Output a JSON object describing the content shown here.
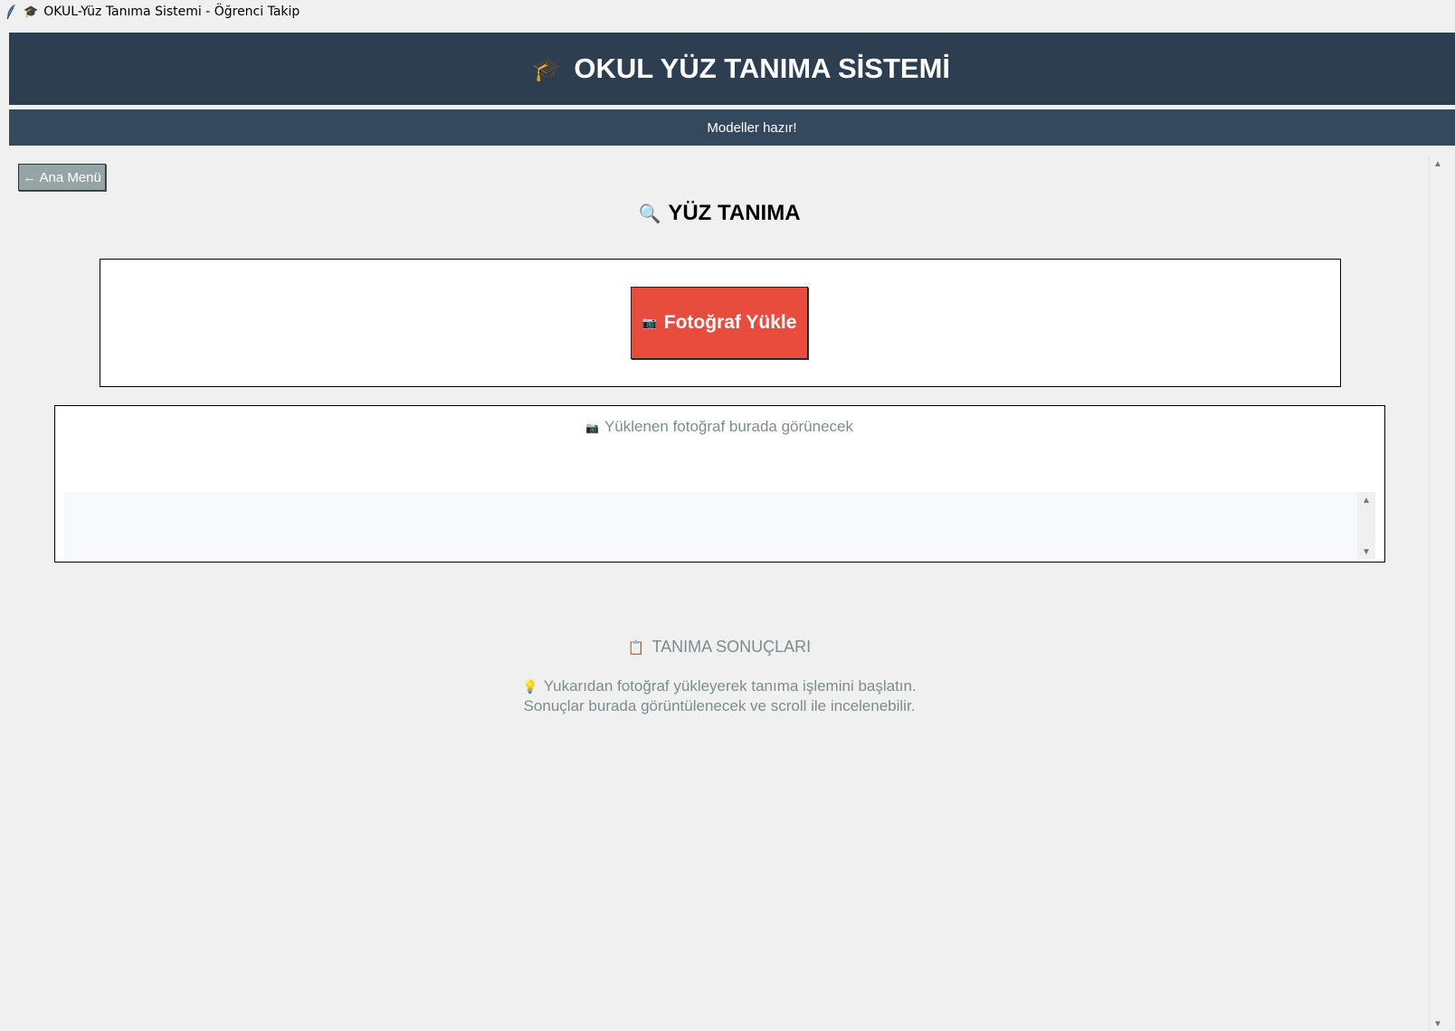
{
  "window": {
    "title": "OKUL-Yüz Tanıma Sistemi - Öğrenci Takip",
    "icon": "feather-icon"
  },
  "header": {
    "icon": "graduation-cap-icon",
    "title": "OKUL YÜZ TANIMA SİSTEMİ"
  },
  "status": {
    "text": "Modeller hazır!"
  },
  "nav": {
    "back_label": "← Ana Menü"
  },
  "page": {
    "icon": "magnifier-icon",
    "title": "YÜZ TANIMA"
  },
  "upload": {
    "icon": "camera-icon",
    "button_label": "Fotoğraf Yükle"
  },
  "preview": {
    "icon": "camera-icon",
    "placeholder": "Yüklenen fotoğraf burada görünecek",
    "textarea_value": ""
  },
  "results": {
    "icon": "clipboard-icon",
    "title": "TANIMA SONUÇLARI",
    "hint_icon": "lightbulb-icon",
    "hint_line1": "Yukarıdan fotoğraf yükleyerek tanıma işlemini başlatın.",
    "hint_line2": "Sonuçlar burada görüntülenecek ve scroll ile incelenebilir."
  },
  "colors": {
    "header_bg": "#2c3e50",
    "status_bg": "#34495e",
    "upload_button": "#e74c3c",
    "back_button": "#95a5a6",
    "muted_text": "#7f8c8d"
  }
}
